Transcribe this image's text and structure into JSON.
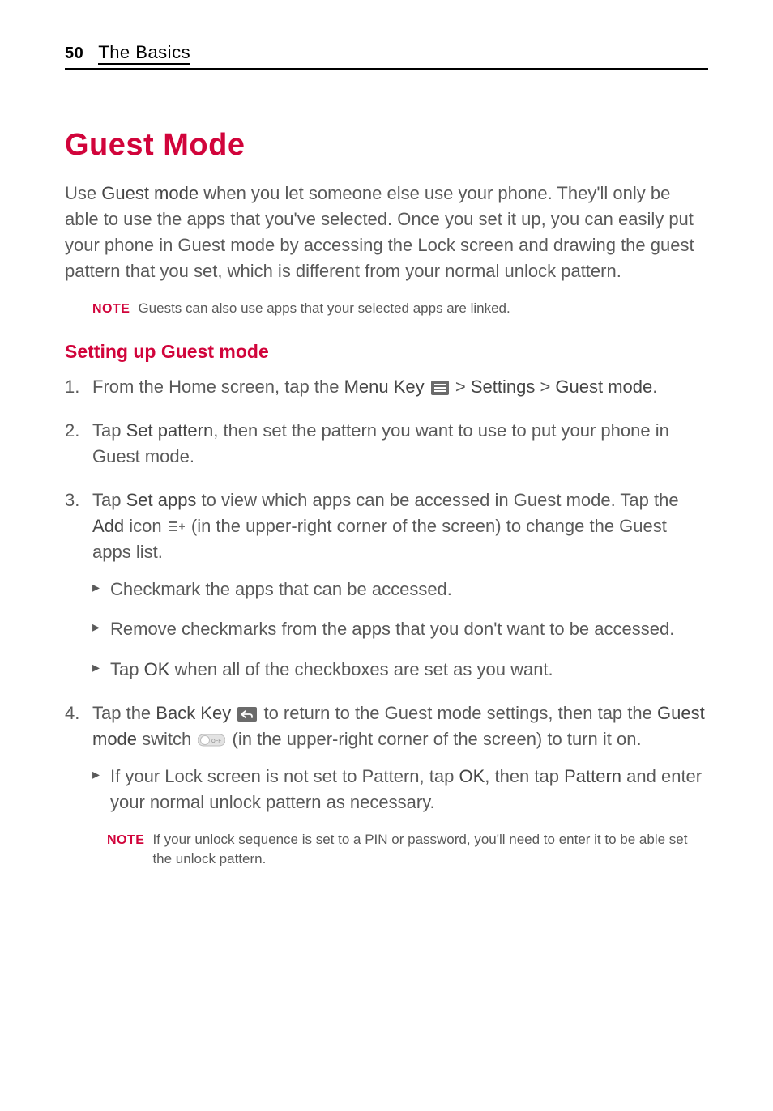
{
  "header": {
    "page_number": "50",
    "section": "The Basics"
  },
  "title": "Guest Mode",
  "intro": {
    "pre": "Use ",
    "bold1": "Guest mode",
    "rest": " when you let someone else use your phone. They'll only be able to use the apps that you've selected. Once you set it up, you can easily put your phone in Guest mode by accessing the Lock screen and drawing the guest pattern that you set, which is different from your normal unlock pattern."
  },
  "note1": {
    "label": "NOTE",
    "text": "Guests can also use apps that your selected apps are linked."
  },
  "subtitle": "Setting up Guest mode",
  "steps": {
    "s1": {
      "a": "From the Home screen, tap the ",
      "b": "Menu Key",
      "c": " > ",
      "d": "Settings",
      "e": " > ",
      "f": "Guest mode",
      "g": "."
    },
    "s2": {
      "a": "Tap ",
      "b": "Set pattern",
      "c": ", then set the pattern you want to use to put your phone in Guest mode."
    },
    "s3": {
      "a": "Tap ",
      "b": "Set apps",
      "c": " to view which apps can be accessed in Guest mode. Tap the ",
      "d": "Add",
      "e": " icon ",
      "f": " (in the upper-right corner of the screen) to change the Guest apps list."
    },
    "s3_b1": "Checkmark the apps that can be accessed.",
    "s3_b2": "Remove checkmarks from the apps that you don't want to be accessed.",
    "s3_b3": {
      "a": "Tap ",
      "b": "OK",
      "c": " when all of the checkboxes are set as you want."
    },
    "s4": {
      "a": "Tap the ",
      "b": "Back Key",
      "c": " to return to the Guest mode settings, then tap the ",
      "d": "Guest mode",
      "e": " switch ",
      "f": " (in the upper-right corner of the screen) to turn it on."
    },
    "s4_b1": {
      "a": "If your Lock screen is not set to Pattern, tap ",
      "b": "OK",
      "c": ", then tap ",
      "d": "Pattern",
      "e": " and enter your normal unlock pattern as necessary."
    }
  },
  "note2": {
    "label": "NOTE",
    "text": "If your unlock sequence is set to a PIN or password, you'll need to enter it to be able set the unlock pattern."
  }
}
